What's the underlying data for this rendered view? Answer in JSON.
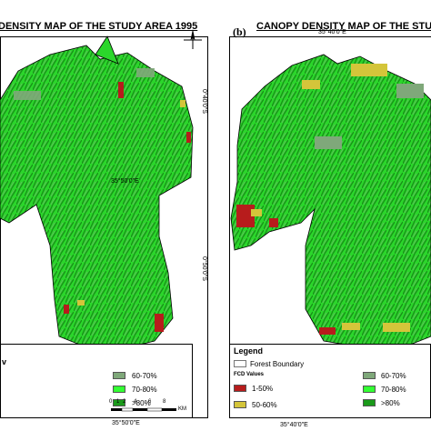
{
  "panel_a": {
    "title": "DENSITY  MAP OF THE STUDY AREA 1995",
    "coord_top_right": "0°40'0\"S",
    "coord_mid_right": "0°50'0\"S",
    "coord_bottom": "35°50'0\"E",
    "coord_mid_bottom": "35°50'0\"E",
    "legend_header_fragment": "v",
    "legend_items": [
      {
        "label": "60-70%",
        "color": "#7fa87a"
      },
      {
        "label": "70-80%",
        "color": "#33ff33"
      },
      {
        "label": ">80%",
        "color": "#1a9a1a"
      }
    ],
    "scale_ticks": [
      "0",
      "1",
      "2",
      "4",
      "6",
      "8"
    ],
    "scale_unit": "KM"
  },
  "panel_b": {
    "label": "(b)",
    "title": "CANOPY DENSITY  MAP OF THE STUDY AREA",
    "coord_top": "35°40'0\"E",
    "coord_bottom": "35°40'0\"E",
    "legend_title": "Legend",
    "boundary_label": "Forest Boundary",
    "fcd_label": "FCD Values",
    "legend_items_left": [
      {
        "label": "1-50%",
        "color": "#b71c1c"
      },
      {
        "label": "50-60%",
        "color": "#d4c53a"
      }
    ],
    "legend_items_right": [
      {
        "label": "60-70%",
        "color": "#7fa87a"
      },
      {
        "label": "70-80%",
        "color": "#33ff33"
      },
      {
        "label": ">80%",
        "color": "#1a9a1a"
      }
    ]
  },
  "colors": {
    "green_main": "#2bd62b",
    "green_light": "#3cff3c",
    "green_dark": "#189018",
    "grey_green": "#7fa87a",
    "red": "#b71c1c",
    "yellow": "#d4c53a"
  },
  "icons": [
    "north-arrow-icon"
  ]
}
